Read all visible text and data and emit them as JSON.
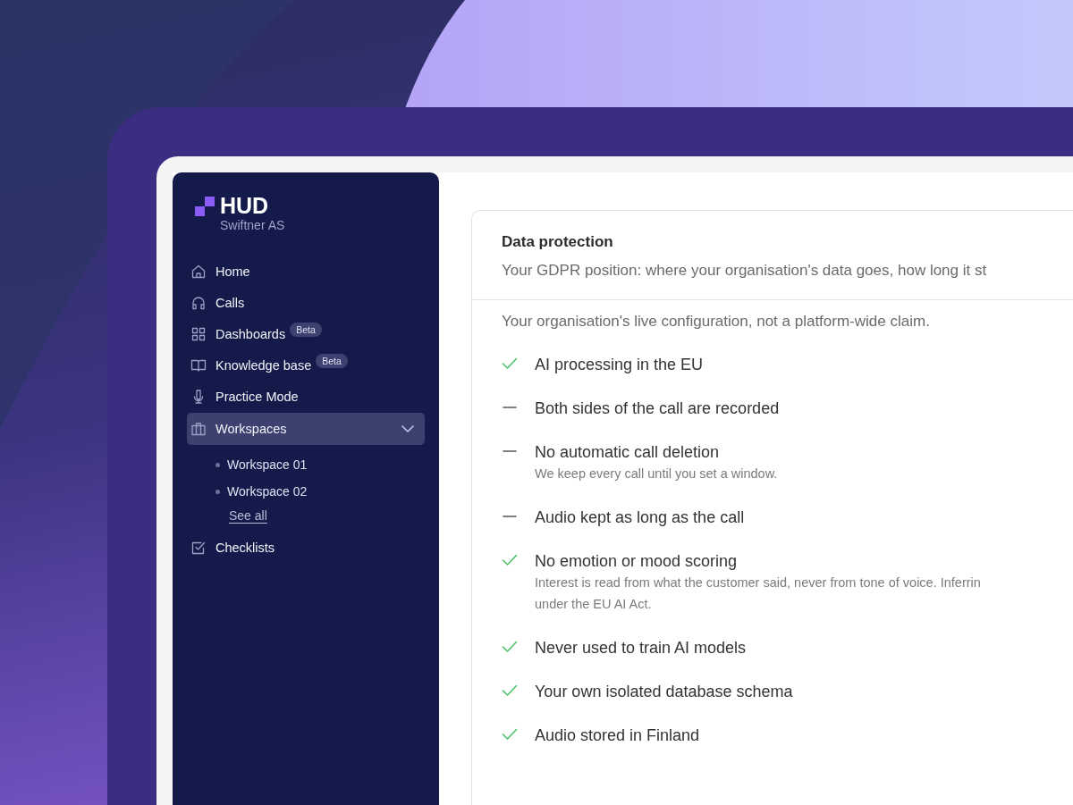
{
  "brand": {
    "name": "HUD",
    "org": "Swiftner AS"
  },
  "nav": [
    {
      "label": "Home",
      "selected": false
    },
    {
      "label": "Calls",
      "selected": false
    },
    {
      "label": "Dashboards",
      "badge": "Beta",
      "selected": false
    },
    {
      "label": "Knowledge base",
      "badge": "Beta",
      "selected": false
    },
    {
      "label": "Practice Mode",
      "selected": false
    },
    {
      "label": "Workspaces",
      "selected": true,
      "expanded": true,
      "children": [
        {
          "label": "Workspace 01"
        },
        {
          "label": "Workspace 02"
        }
      ],
      "link": "See all"
    },
    {
      "label": "Checklists",
      "selected": false
    }
  ],
  "card": {
    "title": "Data protection",
    "description": "Your GDPR position: where your organisation's data goes, how long it st",
    "intro": "Your organisation's live configuration, not a platform-wide claim.",
    "items": [
      {
        "kind": "check",
        "label": "AI processing in the EU"
      },
      {
        "kind": "dash",
        "label": "Both sides of the call are recorded"
      },
      {
        "kind": "dash",
        "label": "No automatic call deletion",
        "note": "We keep every call until you set a window."
      },
      {
        "kind": "dash",
        "label": "Audio kept as long as the call"
      },
      {
        "kind": "check",
        "label": "No emotion or mood scoring",
        "note": "Interest is read from what the customer said, never from tone of voice. Inferrin",
        "note_2": "under the EU AI Act."
      },
      {
        "kind": "check",
        "label": "Never used to train AI models"
      },
      {
        "kind": "check",
        "label": "Your own isolated database schema"
      },
      {
        "kind": "check",
        "label": "Audio stored in Finland"
      }
    ]
  }
}
